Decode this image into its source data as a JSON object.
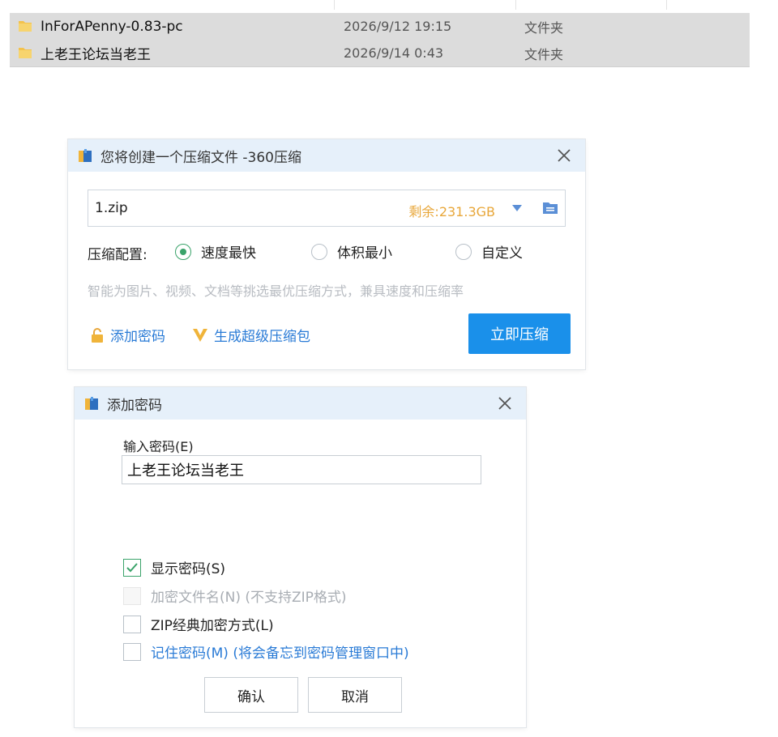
{
  "file_list": [
    {
      "name": "InForAPenny-0.83-pc",
      "date": "2026/9/12 19:15",
      "type": "文件夹"
    },
    {
      "name": "上老王论坛当老王",
      "date": "2026/9/14 0:43",
      "type": "文件夹"
    }
  ],
  "compress_dialog": {
    "title": "您将创建一个压缩文件 -360压缩",
    "filename": "1.zip",
    "free_space": "剩余:231.3GB",
    "config_label": "压缩配置:",
    "options": [
      "速度最快",
      "体积最小",
      "自定义"
    ],
    "selected_option": "速度最快",
    "hint": "智能为图片、视频、文档等挑选最优压缩方式，兼具速度和压缩率",
    "add_password_link": "添加密码",
    "super_package_link": "生成超级压缩包",
    "compress_button": "立即压缩"
  },
  "password_dialog": {
    "title": "添加密码",
    "input_label": "输入密码(E)",
    "password_value": "上老王论坛当老王",
    "checkboxes": [
      {
        "label": "显示密码(S)",
        "checked": true,
        "enabled": true
      },
      {
        "label": "加密文件名(N) (不支持ZIP格式)",
        "checked": false,
        "enabled": false
      },
      {
        "label": "ZIP经典加密方式(L)",
        "checked": false,
        "enabled": true
      },
      {
        "label": "记住密码(M) (将会备忘到密码管理窗口中)",
        "checked": false,
        "enabled": true
      }
    ],
    "ok_button": "确认",
    "cancel_button": "取消"
  },
  "colors": {
    "accent": "#1a90ea",
    "title_bar": "#e6f0fa",
    "free_space": "#e8a73a",
    "link": "#2a7bd6",
    "check_green": "#3aa36a"
  }
}
